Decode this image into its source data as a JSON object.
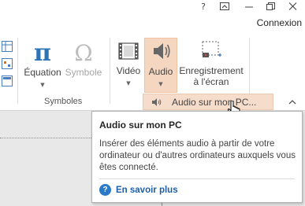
{
  "titlebar": {
    "help": "?",
    "restore_ribbon": "⊼",
    "minimize": "—",
    "maximize": "❐",
    "signin_label": "Connexion"
  },
  "ribbon": {
    "equation_label": "Équation",
    "symbol_label": "Symbole",
    "group_symbols_label": "Symboles",
    "video_label": "Vidéo",
    "audio_label": "Audio",
    "screen_recording_label_1": "Enregistrement",
    "screen_recording_label_2": "à l'écran",
    "collapse_caret": "^"
  },
  "dropdown": {
    "audio_on_pc": "Audio sur mon PC..."
  },
  "tooltip": {
    "title": "Audio sur mon PC",
    "description": "Insérer des éléments audio à partir de votre ordinateur ou d'autres ordinateurs auxquels vous êtes connecté.",
    "help_link": "En savoir plus"
  },
  "colors": {
    "audio_highlight": "#f5d7c1",
    "accent_red": "#c0504d",
    "help_blue": "#2b79c9"
  }
}
